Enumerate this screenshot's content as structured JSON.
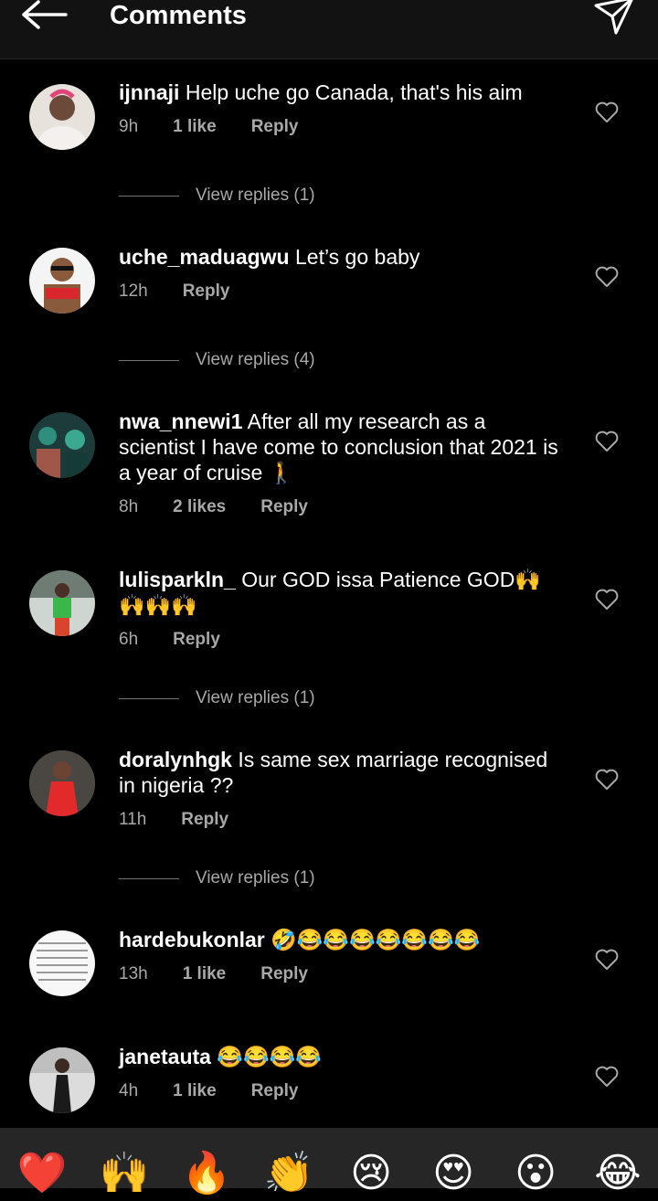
{
  "header": {
    "title": "Comments"
  },
  "comments": [
    {
      "username": "ijnnaji",
      "text": "Help uche go Canada, that's his aim",
      "time": "9h",
      "likes": "1 like",
      "reply": "Reply",
      "view_replies": "View replies (1)"
    },
    {
      "username": "uche_maduagwu",
      "text": "Let’s go baby",
      "time": "12h",
      "likes": "",
      "reply": "Reply",
      "view_replies": "View replies (4)"
    },
    {
      "username": "nwa_nnewi1",
      "text": "After all my research as a scientist I have come to conclusion that 2021 is a year of cruise 🚶",
      "time": "8h",
      "likes": "2 likes",
      "reply": "Reply",
      "view_replies": ""
    },
    {
      "username": "lulisparkln_",
      "text": "Our GOD issa Patience GOD🙌🙌🙌🙌",
      "time": "6h",
      "likes": "",
      "reply": "Reply",
      "view_replies": "View replies (1)"
    },
    {
      "username": "doralynhgk",
      "text": "Is same sex marriage recognised in nigeria ??",
      "time": "11h",
      "likes": "",
      "reply": "Reply",
      "view_replies": "View replies (1)"
    },
    {
      "username": "hardebukonlar",
      "text": "🤣😂😂😂😂😂😂😂",
      "time": "13h",
      "likes": "1 like",
      "reply": "Reply",
      "view_replies": ""
    },
    {
      "username": "janetauta",
      "text": "😂😂😂😂",
      "time": "4h",
      "likes": "1 like",
      "reply": "Reply",
      "view_replies": ""
    }
  ],
  "reactions": [
    "❤️",
    "🙌",
    "🔥",
    "👏",
    "😢",
    "😍",
    "😮",
    "😂"
  ]
}
